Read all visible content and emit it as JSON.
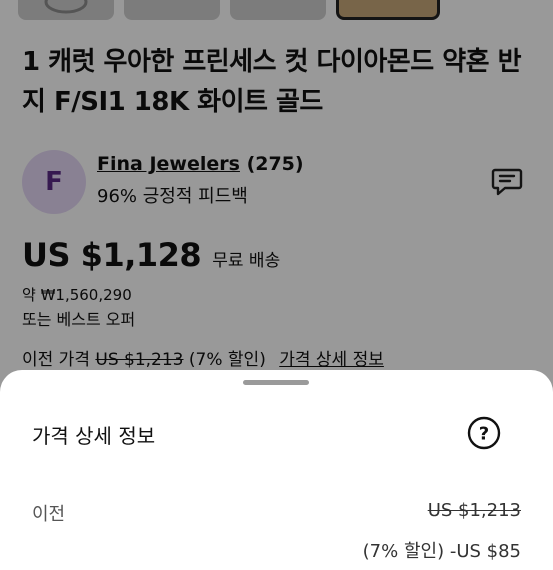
{
  "listing": {
    "title": "1 캐럿 우아한 프린세스 컷 다이아몬드 약혼 반지 F/SI1 18K 화이트 골드",
    "seller": {
      "avatar_letter": "F",
      "name": "Fina Jewelers",
      "feedback_count": "(275)",
      "feedback_text": "96% 긍정적 피드백"
    },
    "price": "US $1,128",
    "shipping": "무료 배송",
    "approx_price": "약 ₩1,560,290",
    "best_offer": "또는 베스트 오퍼",
    "previous_price_label": "이전 가격",
    "previous_price": "US $1,213",
    "discount": "(7% 할인)",
    "price_details_link": "가격 상세 정보"
  },
  "sheet": {
    "title": "가격 상세 정보",
    "previous_label": "이전",
    "previous_value": "US $1,213",
    "discount_text": "(7% 할인) -US $85"
  },
  "icons": {
    "message": "message-icon",
    "help": "help-icon",
    "ring": "ring-icon"
  },
  "colors": {
    "avatar_bg": "#e4d8f5",
    "avatar_text": "#5b2a86",
    "overlay": "rgba(0,0,0,0.4)"
  }
}
